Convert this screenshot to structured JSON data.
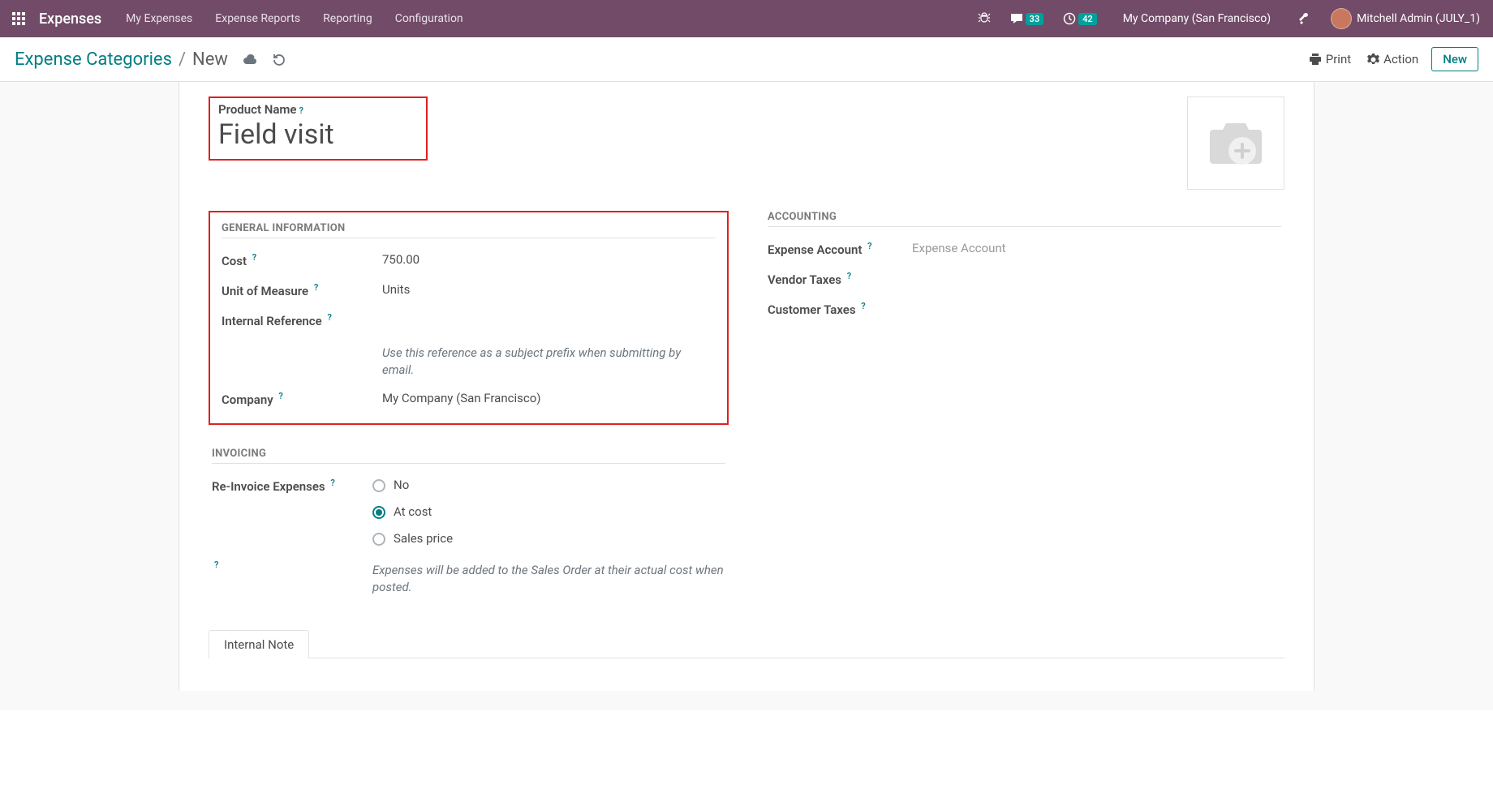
{
  "navbar": {
    "brand": "Expenses",
    "items": [
      "My Expenses",
      "Expense Reports",
      "Reporting",
      "Configuration"
    ],
    "messages_count": "33",
    "activities_count": "42",
    "company": "My Company (San Francisco)",
    "user": "Mitchell Admin (JULY_1)"
  },
  "control_panel": {
    "breadcrumb_root": "Expense Categories",
    "breadcrumb_current": "New",
    "print_label": "Print",
    "action_label": "Action",
    "new_label": "New"
  },
  "form": {
    "product_name_label": "Product Name",
    "product_name_value": "Field visit",
    "sections": {
      "general": {
        "title": "General Information",
        "cost_label": "Cost",
        "cost_value": "750.00",
        "uom_label": "Unit of Measure",
        "uom_value": "Units",
        "iref_label": "Internal Reference",
        "iref_hint": "Use this reference as a subject prefix when submitting by email.",
        "company_label": "Company",
        "company_value": "My Company (San Francisco)"
      },
      "invoicing": {
        "title": "Invoicing",
        "reinvoice_label": "Re-Invoice Expenses",
        "options": [
          "No",
          "At cost",
          "Sales price"
        ],
        "hint": "Expenses will be added to the Sales Order at their actual cost when posted."
      },
      "accounting": {
        "title": "Accounting",
        "expense_account_label": "Expense Account",
        "expense_account_placeholder": "Expense Account",
        "vendor_taxes_label": "Vendor Taxes",
        "customer_taxes_label": "Customer Taxes"
      }
    },
    "tabs": [
      "Internal Note"
    ]
  }
}
